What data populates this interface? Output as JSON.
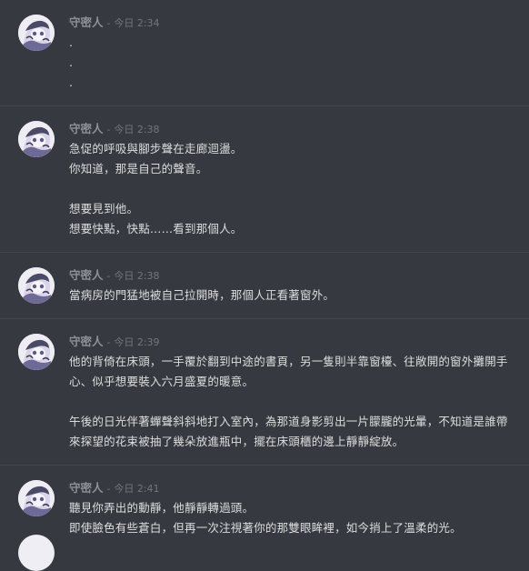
{
  "messages": [
    {
      "author": "守密人",
      "separator": "-",
      "time": "今日 2:34",
      "lines": [
        ".",
        ".",
        "."
      ]
    },
    {
      "author": "守密人",
      "separator": "-",
      "time": "今日 2:38",
      "lines": [
        "急促的呼吸與腳步聲在走廊迴盪。",
        "你知道，那是自己的聲音。",
        "",
        "想要見到他。",
        "想要快點，快點……看到那個人。"
      ]
    },
    {
      "author": "守密人",
      "separator": "-",
      "time": "今日 2:38",
      "lines": [
        "當病房的門猛地被自己拉開時，那個人正看著窗外。"
      ]
    },
    {
      "author": "守密人",
      "separator": "-",
      "time": "今日 2:39",
      "lines": [
        "他的背倚在床頭，一手覆於翻到中途的書頁，另一隻則半靠窗檯、往敞開的窗外攤開手心、似乎想要裝入六月盛夏的暖意。",
        "",
        "午後的日光伴著蟬聲斜斜地打入室內，為那道身影剪出一片朦朧的光暈，不知道是誰帶來探望的花束被抽了幾朵放進瓶中，擺在床頭櫃的邊上靜靜綻放。"
      ]
    },
    {
      "author": "守密人",
      "separator": "-",
      "time": "今日 2:41",
      "lines": [
        "聽見你弄出的動靜，他靜靜轉過頭。",
        "即使臉色有些蒼白，但再一次注視著你的那雙眼眸裡，如今捎上了溫柔的光。"
      ]
    }
  ],
  "avatar_icon": "character-portrait-icon",
  "colors": {
    "background": "#36393f",
    "author": "#8e9297",
    "timestamp": "#72767d",
    "text": "#dcddde",
    "divider": "#42454a"
  }
}
